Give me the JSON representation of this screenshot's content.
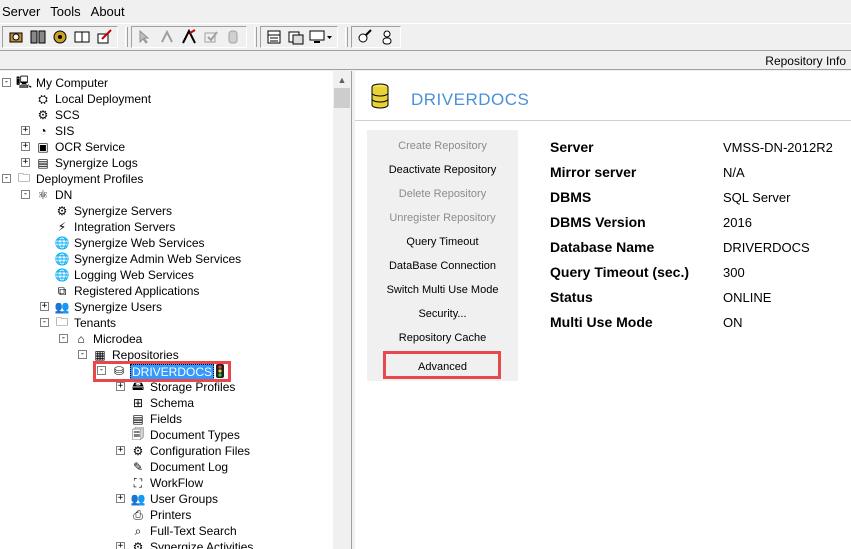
{
  "menu": [
    "Server",
    "Tools",
    "About"
  ],
  "toolbar": {
    "groups": [
      [
        "deployment-icon",
        "servers-icon",
        "sis-icon",
        "docs-icon",
        "edit-icon"
      ],
      [
        "arrow-disabled-icon",
        "branch-disabled-icon",
        "run-icon",
        "check-disabled-icon",
        "db-disabled-icon"
      ],
      [
        "panel-icon",
        "window-icon",
        "monitor-dropdown-icon"
      ],
      [
        "tools-icon",
        "user-icon"
      ]
    ]
  },
  "infobar": {
    "label": "Repository Info"
  },
  "tree": [
    {
      "label": "My Computer",
      "icon": "computer-icon",
      "glyph": "🖳",
      "level": 0,
      "exp": "-"
    },
    {
      "label": "Local Deployment",
      "icon": "deployment-icon",
      "glyph": "⛭",
      "level": 1,
      "exp": ""
    },
    {
      "label": "SCS",
      "icon": "servers-icon",
      "glyph": "⚙",
      "level": 1,
      "exp": ""
    },
    {
      "label": "SIS",
      "icon": "sis-icon",
      "glyph": "◔",
      "level": 1,
      "exp": "+"
    },
    {
      "label": "OCR Service",
      "icon": "ocr-icon",
      "glyph": "▣",
      "level": 1,
      "exp": "+"
    },
    {
      "label": "Synergize Logs",
      "icon": "logs-icon",
      "glyph": "▤",
      "level": 1,
      "exp": "+"
    },
    {
      "label": "Deployment Profiles",
      "icon": "folder-icon",
      "glyph": "🗀",
      "level": 0,
      "exp": "-"
    },
    {
      "label": "DN",
      "icon": "network-icon",
      "glyph": "⚛",
      "level": 1,
      "exp": "-"
    },
    {
      "label": "Synergize Servers",
      "icon": "server-icon",
      "glyph": "⚙",
      "level": 2,
      "exp": ""
    },
    {
      "label": "Integration Servers",
      "icon": "integration-icon",
      "glyph": "⚡",
      "level": 2,
      "exp": ""
    },
    {
      "label": "Synergize Web Services",
      "icon": "globe-icon",
      "glyph": "🌐",
      "level": 2,
      "exp": ""
    },
    {
      "label": "Synergize Admin Web Services",
      "icon": "globe-icon",
      "glyph": "🌐",
      "level": 2,
      "exp": ""
    },
    {
      "label": "Logging Web Services",
      "icon": "globe-icon",
      "glyph": "🌐",
      "level": 2,
      "exp": ""
    },
    {
      "label": "Registered Applications",
      "icon": "apps-icon",
      "glyph": "⧉",
      "level": 2,
      "exp": ""
    },
    {
      "label": "Synergize Users",
      "icon": "users-icon",
      "glyph": "👥",
      "level": 2,
      "exp": "+"
    },
    {
      "label": "Tenants",
      "icon": "folder-icon",
      "glyph": "🗀",
      "level": 2,
      "exp": "-"
    },
    {
      "label": "Microdea",
      "icon": "tenant-icon",
      "glyph": "⌂",
      "level": 3,
      "exp": "-"
    },
    {
      "label": "Repositories",
      "icon": "repositories-icon",
      "glyph": "▦",
      "level": 4,
      "exp": "-"
    },
    {
      "label": "DRIVERDOCS",
      "icon": "database-icon",
      "glyph": "⛁",
      "level": 5,
      "exp": "-",
      "selected": true
    },
    {
      "label": "Storage Profiles",
      "icon": "storage-icon",
      "glyph": "🖴",
      "level": 6,
      "exp": "+"
    },
    {
      "label": "Schema",
      "icon": "schema-icon",
      "glyph": "⊞",
      "level": 6,
      "exp": ""
    },
    {
      "label": "Fields",
      "icon": "fields-icon",
      "glyph": "▤",
      "level": 6,
      "exp": ""
    },
    {
      "label": "Document Types",
      "icon": "doctypes-icon",
      "glyph": "🗐",
      "level": 6,
      "exp": ""
    },
    {
      "label": "Configuration Files",
      "icon": "config-icon",
      "glyph": "⚙",
      "level": 6,
      "exp": "+"
    },
    {
      "label": "Document Log",
      "icon": "doclog-icon",
      "glyph": "✎",
      "level": 6,
      "exp": ""
    },
    {
      "label": "WorkFlow",
      "icon": "workflow-icon",
      "glyph": "⛶",
      "level": 6,
      "exp": ""
    },
    {
      "label": "User Groups",
      "icon": "usergroups-icon",
      "glyph": "👥",
      "level": 6,
      "exp": "+"
    },
    {
      "label": "Printers",
      "icon": "printer-icon",
      "glyph": "⎙",
      "level": 6,
      "exp": ""
    },
    {
      "label": "Full-Text Search",
      "icon": "search-icon",
      "glyph": "⌕",
      "level": 6,
      "exp": ""
    },
    {
      "label": "Synergize Activities",
      "icon": "activities-icon",
      "glyph": "⚙",
      "level": 6,
      "exp": "+"
    }
  ],
  "repo": {
    "title": "DRIVERDOCS",
    "actions": [
      {
        "label": "Create Repository",
        "enabled": false
      },
      {
        "label": "Deactivate Repository",
        "enabled": true
      },
      {
        "label": "Delete Repository",
        "enabled": false
      },
      {
        "label": "Unregister Repository",
        "enabled": false
      },
      {
        "label": "Query Timeout",
        "enabled": true
      },
      {
        "label": "DataBase Connection",
        "enabled": true
      },
      {
        "label": "Switch Multi Use Mode",
        "enabled": true
      },
      {
        "label": "Security...",
        "enabled": true
      },
      {
        "label": "Repository Cache",
        "enabled": true
      },
      {
        "label": "Advanced",
        "enabled": true
      }
    ],
    "info": [
      {
        "key": "Server",
        "value": "VMSS-DN-2012R2"
      },
      {
        "key": "Mirror server",
        "value": "N/A"
      },
      {
        "key": "DBMS",
        "value": "SQL Server"
      },
      {
        "key": "DBMS Version",
        "value": "2016"
      },
      {
        "key": "Database Name",
        "value": "DRIVERDOCS"
      },
      {
        "key": "Query Timeout (sec.)",
        "value": "300"
      },
      {
        "key": "Status",
        "value": "ONLINE"
      },
      {
        "key": "Multi Use Mode",
        "value": "ON"
      }
    ]
  },
  "colors": {
    "accent": "#4a90d9",
    "highlight": "#e8484c",
    "selection": "#3399ff"
  }
}
